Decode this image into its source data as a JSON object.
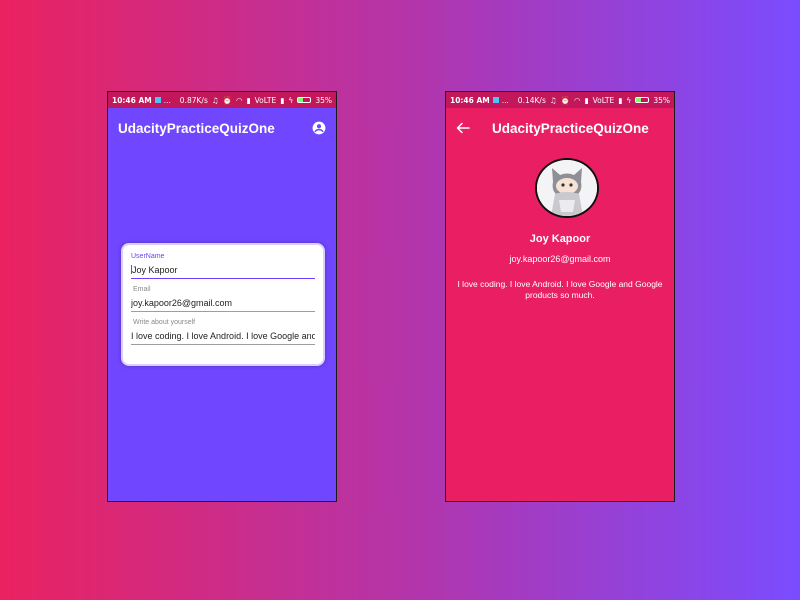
{
  "status_left": {
    "time": "10:46 AM",
    "dots": "...",
    "speed": "0.87K/s",
    "network": "VoLTE",
    "battery": "35%"
  },
  "status_right": {
    "time": "10:46 AM",
    "dots": "...",
    "speed": "0.14K/s",
    "network": "VoLTE",
    "battery": "35%"
  },
  "app_title": "UdacityPracticeQuizOne",
  "form": {
    "username_label": "UserName",
    "username_value": "Joy Kapoor",
    "email_label": "Email",
    "email_value": "joy.kapoor26@gmail.com",
    "about_label": "Write about yourself",
    "about_value": "I love coding. I love Android. I love Google and Google products so much."
  },
  "profile": {
    "name": "Joy Kapoor",
    "email": "joy.kapoor26@gmail.com",
    "about": "I love coding. I love Android. I love Google and Google products so much."
  },
  "colors": {
    "left_screen": "#7046ff",
    "right_screen": "#e91e63",
    "status_bar": "#c2185b",
    "accent": "#6c40ff"
  },
  "icons": [
    "account-circle-icon",
    "back-arrow-icon",
    "wifi-icon",
    "signal-icon",
    "battery-icon"
  ]
}
